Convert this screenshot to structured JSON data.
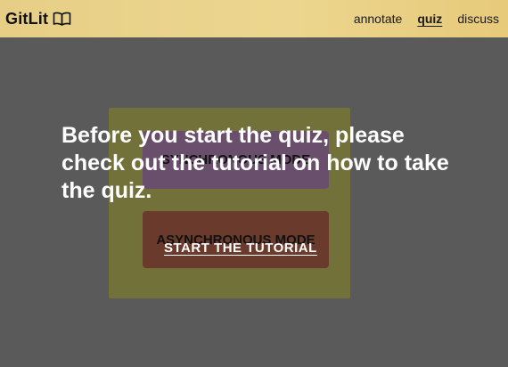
{
  "header": {
    "brand": "GitLit",
    "brand_icon": "book-icon",
    "nav": [
      {
        "label": "annotate",
        "active": false
      },
      {
        "label": "quiz",
        "active": true
      },
      {
        "label": "discuss",
        "active": false
      }
    ],
    "background": "#e9d188"
  },
  "card": {
    "mode_sync_label": "SYNCHRONOUS MODE",
    "mode_async_label": "ASYNCHRONOUS MODE"
  },
  "overlay": {
    "message": "Before you start the quiz, please check out the tutorial on how to take the quiz.",
    "tutorial_link": "START THE TUTORIAL",
    "dim_color": "#5a5a5a"
  }
}
